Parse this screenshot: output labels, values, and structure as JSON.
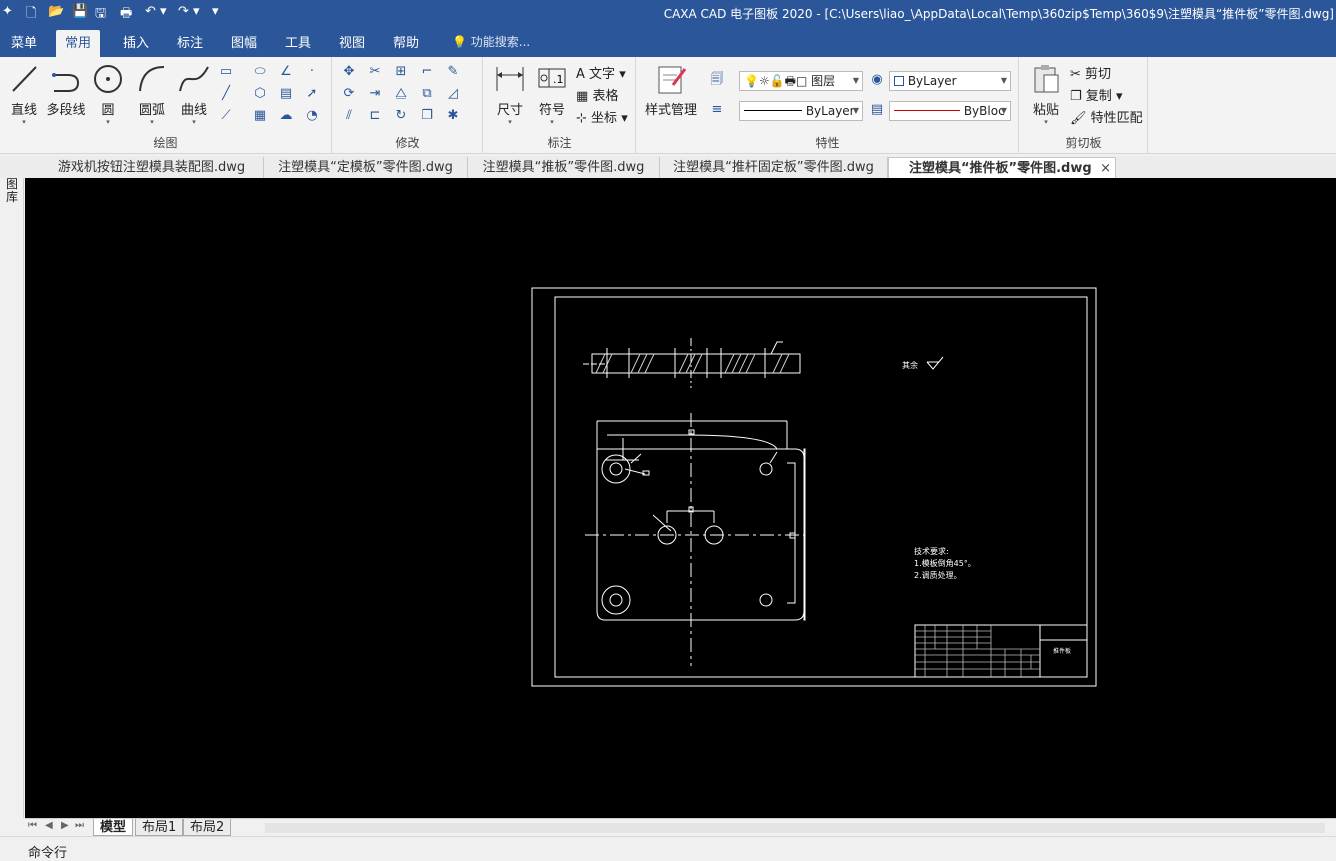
{
  "window": {
    "title": "CAXA CAD 电子图板 2020 - [C:\\Users\\liao_\\AppData\\Local\\Temp\\360zip$Temp\\360$9\\注塑模具“推件板”零件图.dwg]"
  },
  "quick_access": {
    "icons": [
      "app-icon",
      "new-icon",
      "open-icon",
      "save-icon",
      "save-as-icon",
      "print-icon",
      "undo-icon",
      "redo-icon",
      "customize-icon"
    ]
  },
  "ribbon_tabs": [
    {
      "label": "菜单"
    },
    {
      "label": "常用"
    },
    {
      "label": "插入"
    },
    {
      "label": "标注"
    },
    {
      "label": "图幅"
    },
    {
      "label": "工具"
    },
    {
      "label": "视图"
    },
    {
      "label": "帮助"
    }
  ],
  "search": {
    "placeholder": "功能搜索..."
  },
  "groups": {
    "draw": {
      "label": "绘图",
      "buttons": [
        "直线",
        "多段线",
        "圆",
        "圆弧",
        "曲线"
      ]
    },
    "modify": {
      "label": "修改"
    },
    "annotate": {
      "label": "标注",
      "buttons": [
        "尺寸",
        "符号"
      ],
      "small": [
        "文字",
        "表格",
        "坐标"
      ]
    },
    "properties": {
      "label": "特性",
      "style_button": "样式管理",
      "layer": "图层",
      "color": "ByLayer",
      "linetype": "ByLayer",
      "lineweight": "ByBloc"
    },
    "clipboard": {
      "label": "剪切板",
      "paste": "粘贴",
      "small": [
        "剪切",
        "复制",
        "特性匹配"
      ]
    }
  },
  "doc_tabs": [
    {
      "label": "游戏机按钮注塑模具装配图.dwg"
    },
    {
      "label": "注塑模具“定模板”零件图.dwg"
    },
    {
      "label": "注塑模具“推板”零件图.dwg"
    },
    {
      "label": "注塑模具“推杆固定板”零件图.dwg"
    },
    {
      "label": "注塑模具“推件板”零件图.dwg"
    }
  ],
  "left_panel": {
    "label": "图库"
  },
  "drawing": {
    "roughness_note": "其余",
    "tech_title": "技术要求:",
    "tech_items": [
      "1.模板倒角45°。",
      "2.调质处理。"
    ],
    "part_name": "推件板"
  },
  "layout_tabs": [
    {
      "label": "模型"
    },
    {
      "label": "布局1"
    },
    {
      "label": "布局2"
    }
  ],
  "command": {
    "label": "命令行"
  }
}
